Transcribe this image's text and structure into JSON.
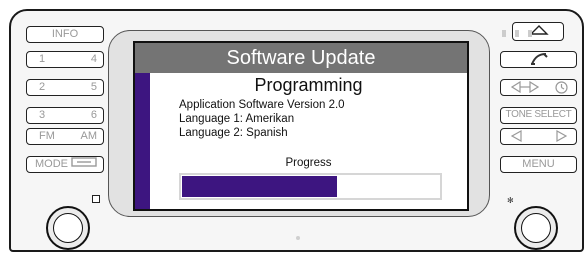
{
  "screen": {
    "title": "Software Update",
    "heading": "Programming",
    "info_lines": [
      "Application Software Version 2.0",
      "Language 1: Amerikan",
      "Language 2: Spanish"
    ],
    "progress_label": "Progress",
    "progress_fraction": 0.6
  },
  "left_buttons": {
    "info": "INFO",
    "preset_1": "1",
    "preset_4": "4",
    "preset_2": "2",
    "preset_5": "5",
    "preset_3": "3",
    "preset_6": "6",
    "fm": "FM",
    "am": "AM",
    "mode": "MODE"
  },
  "right_buttons": {
    "tone_select": "TONE SELECT",
    "menu": "MENU"
  },
  "colors": {
    "title_bar": "#747474",
    "accent": "#3d1580"
  }
}
